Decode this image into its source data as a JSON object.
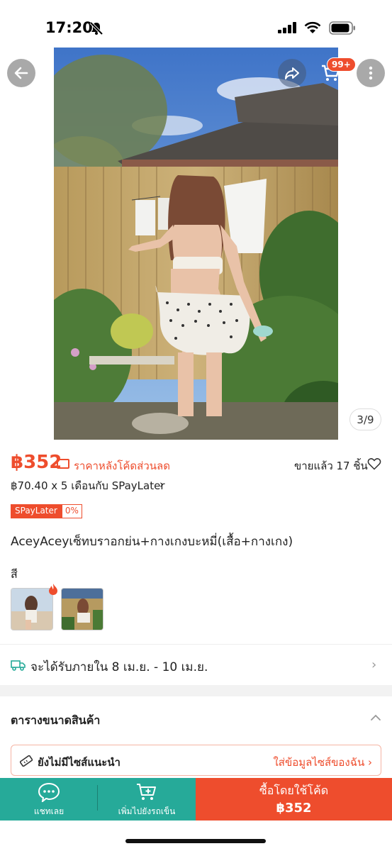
{
  "status_bar": {
    "time": "17:20"
  },
  "header": {
    "cart_count": "99+"
  },
  "gallery": {
    "page_indicator": "3/9"
  },
  "product": {
    "price": "฿352",
    "price_note": "ราคาหลังโค้ดส่วนลด",
    "sold": "ขายแล้ว 17 ชิ้น",
    "installment": "฿70.40 x 5 เดือนกับ SPayLater",
    "spaylater_label": "SPayLater",
    "spaylater_rate": "0%",
    "title": "AceyAceyเซ็ทบราอกย่น+กางเกงบะหมี่(เสื้อ+กางเกง)",
    "color_label": "สี"
  },
  "delivery": {
    "text": "จะได้รับภายใน 8 เม.ย. - 10 เม.ย."
  },
  "size_chart": {
    "title": "ตารางขนาดสินค้า",
    "no_size": "ยังไม่มีไซส์แนะนำ",
    "enter_size": "ใส่ข้อมูลไซส์ของฉัน ›"
  },
  "bottom_bar": {
    "chat_label": "แชทเลย",
    "add_cart_label": "เพิ่มไปยังรถเข็น",
    "buy_label": "ซื้อโดยใช้โค้ด",
    "buy_price": "฿352"
  },
  "colors": {
    "accent": "#ee4d2d",
    "teal": "#26aa99"
  }
}
